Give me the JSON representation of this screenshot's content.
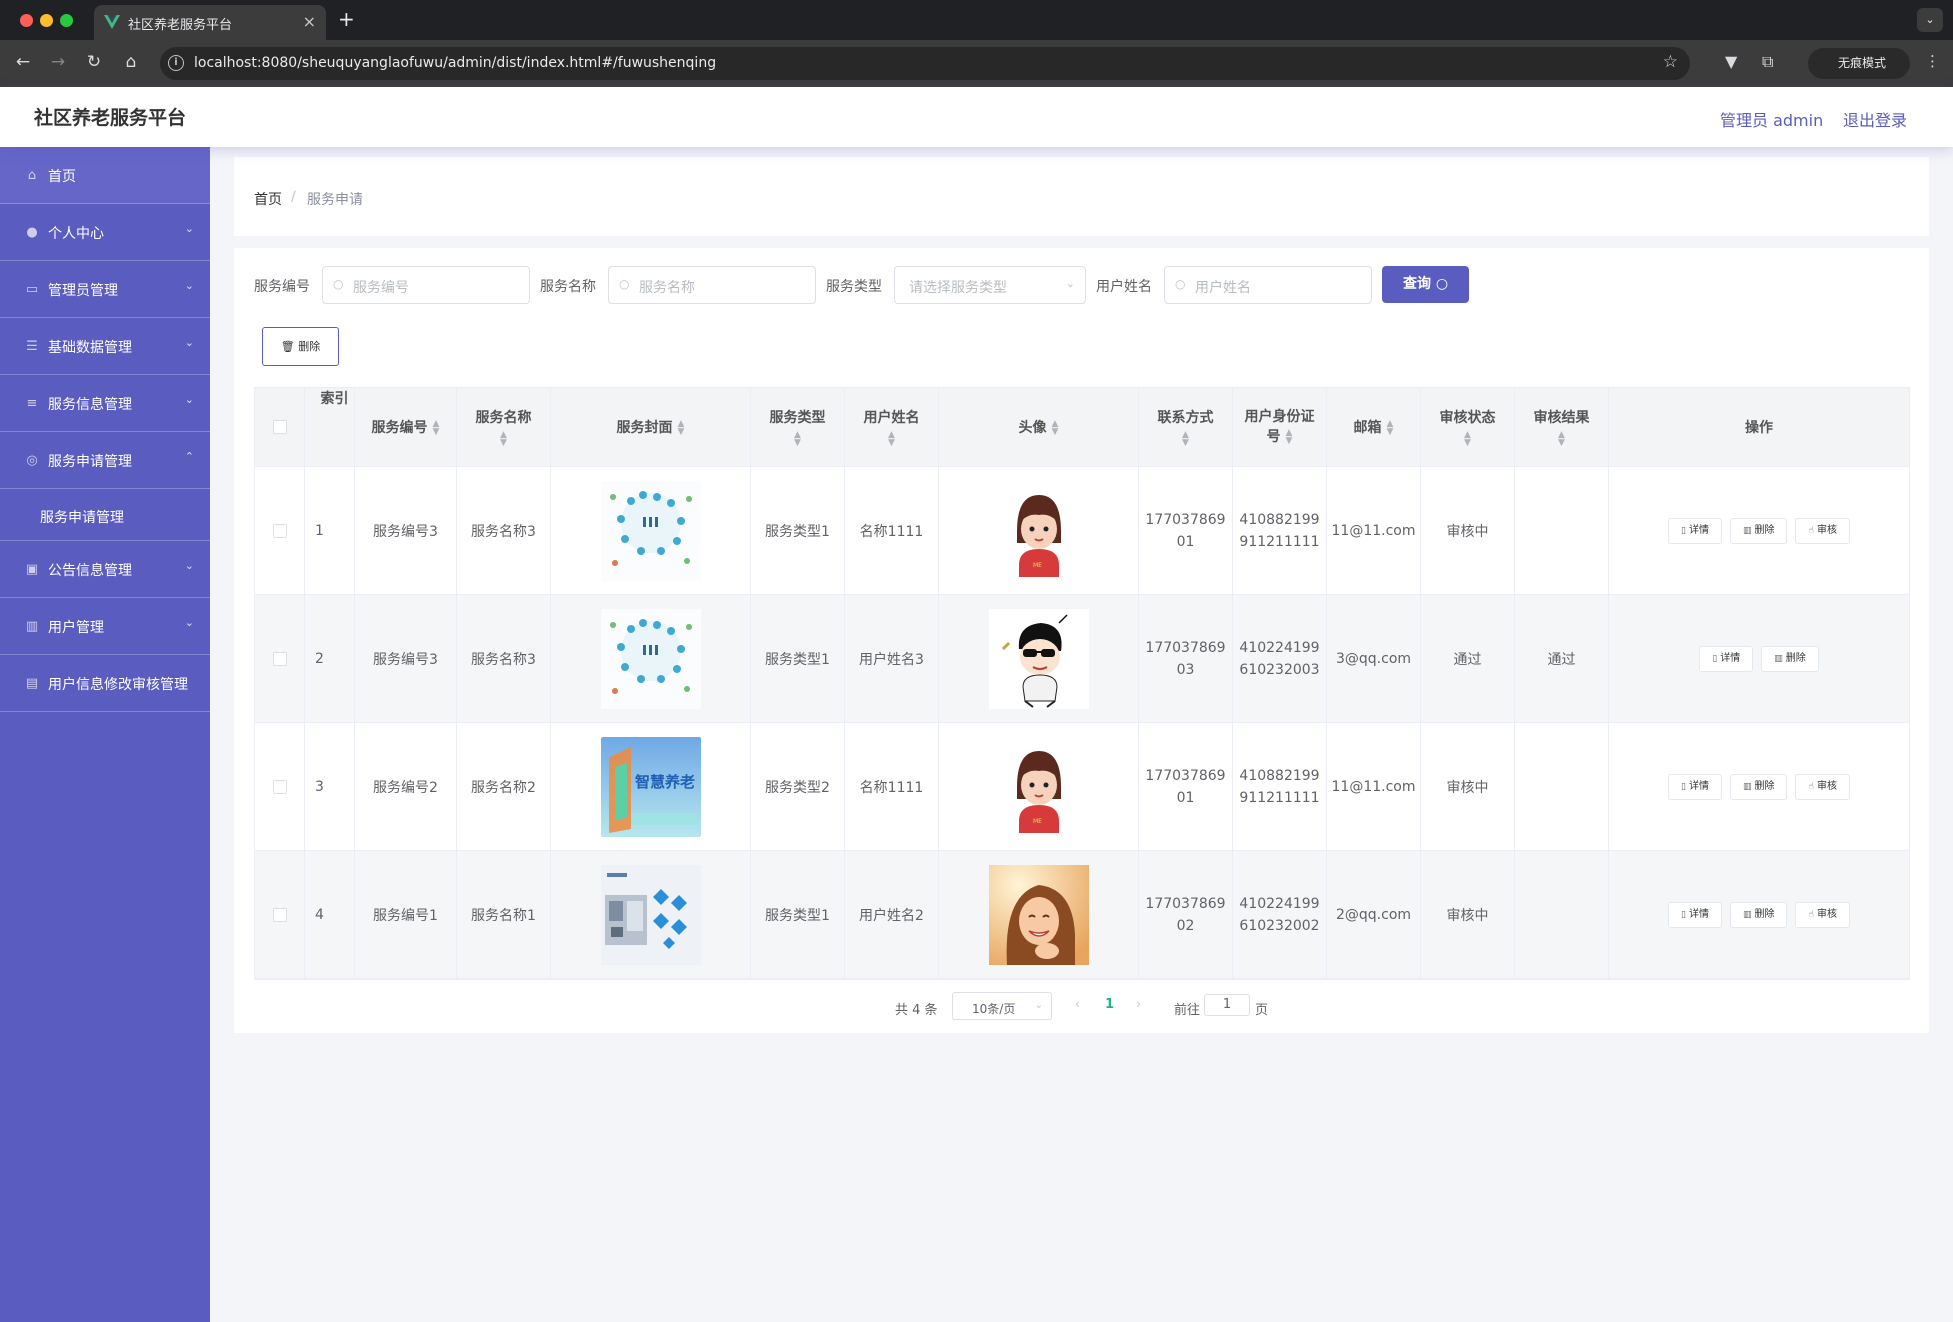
{
  "browser": {
    "tab_title": "社区养老服务平台",
    "url": "localhost:8080/sheuquyanglaofuwu/admin/dist/index.html#/fuwushenqing",
    "incognito_label": "无痕模式"
  },
  "header": {
    "app_title": "社区养老服务平台",
    "admin_label": "管理员 admin",
    "logout_label": "退出登录"
  },
  "sidebar": {
    "items": [
      {
        "label": "首页",
        "icon": "home-icon"
      },
      {
        "label": "个人中心",
        "icon": "user-icon"
      },
      {
        "label": "管理员管理",
        "icon": "monitor-icon"
      },
      {
        "label": "基础数据管理",
        "icon": "sliders-icon"
      },
      {
        "label": "服务信息管理",
        "icon": "list-icon"
      },
      {
        "label": "服务申请管理",
        "icon": "target-icon"
      },
      {
        "label": "公告信息管理",
        "icon": "clipboard-check-icon"
      },
      {
        "label": "用户管理",
        "icon": "chart-icon"
      },
      {
        "label": "用户信息修改审核管理",
        "icon": "clipboard-icon"
      }
    ],
    "submenu_label": "服务申请管理"
  },
  "breadcrumb": {
    "home": "首页",
    "separator": "/",
    "current": "服务申请"
  },
  "filters": {
    "service_no_label": "服务编号",
    "service_no_placeholder": "服务编号",
    "service_name_label": "服务名称",
    "service_name_placeholder": "服务名称",
    "service_type_label": "服务类型",
    "service_type_placeholder": "请选择服务类型",
    "user_name_label": "用户姓名",
    "user_name_placeholder": "用户姓名",
    "query_button": "查询",
    "delete_button": "删除"
  },
  "table": {
    "headers": {
      "index": "索引",
      "service_no": "服务编号",
      "service_name": "服务名称",
      "cover": "服务封面",
      "service_type": "服务类型",
      "user_name": "用户姓名",
      "avatar": "头像",
      "phone": "联系方式",
      "id_card_1": "用户身份证",
      "id_card_2": "号",
      "email": "邮箱",
      "audit_status": "审核状态",
      "audit_result": "审核结果",
      "actions": "操作"
    },
    "action_labels": {
      "detail": "详情",
      "delete": "删除",
      "audit": "审核"
    },
    "rows": [
      {
        "index": "1",
        "service_no": "服务编号3",
        "service_name": "服务名称3",
        "cover": "people-network",
        "service_type": "服务类型1",
        "user_name": "名称1111",
        "avatar": "cartoon-girl",
        "phone_1": "177037869",
        "phone_2": "01",
        "id_1": "410882199",
        "id_2": "911211111",
        "email": "11@11.com",
        "audit_status": "审核中",
        "audit_result": ""
      },
      {
        "index": "2",
        "service_no": "服务编号3",
        "service_name": "服务名称3",
        "cover": "people-network",
        "service_type": "服务类型1",
        "user_name": "用户姓名3",
        "avatar": "cartoon-boy",
        "phone_1": "177037869",
        "phone_2": "03",
        "id_1": "410224199",
        "id_2": "610232003",
        "email": "3@qq.com",
        "audit_status": "通过",
        "audit_result": "通过"
      },
      {
        "index": "3",
        "service_no": "服务编号2",
        "service_name": "服务名称2",
        "cover": "smart-elderly-care",
        "cover_text": "智慧养老",
        "service_type": "服务类型2",
        "user_name": "名称1111",
        "avatar": "cartoon-girl",
        "phone_1": "177037869",
        "phone_2": "01",
        "id_1": "410882199",
        "id_2": "911211111",
        "email": "11@11.com",
        "audit_status": "审核中",
        "audit_result": ""
      },
      {
        "index": "4",
        "service_no": "服务编号1",
        "service_name": "服务名称1",
        "cover": "room-diamonds",
        "service_type": "服务类型1",
        "user_name": "用户姓名2",
        "avatar": "smiling-woman",
        "phone_1": "177037869",
        "phone_2": "02",
        "id_1": "410224199",
        "id_2": "610232002",
        "email": "2@qq.com",
        "audit_status": "审核中",
        "audit_result": ""
      }
    ]
  },
  "pagination": {
    "total": "共 4 条",
    "page_size": "10条/页",
    "current_page": "1",
    "goto_label": "前往",
    "goto_value": "1",
    "page_suffix": "页"
  }
}
